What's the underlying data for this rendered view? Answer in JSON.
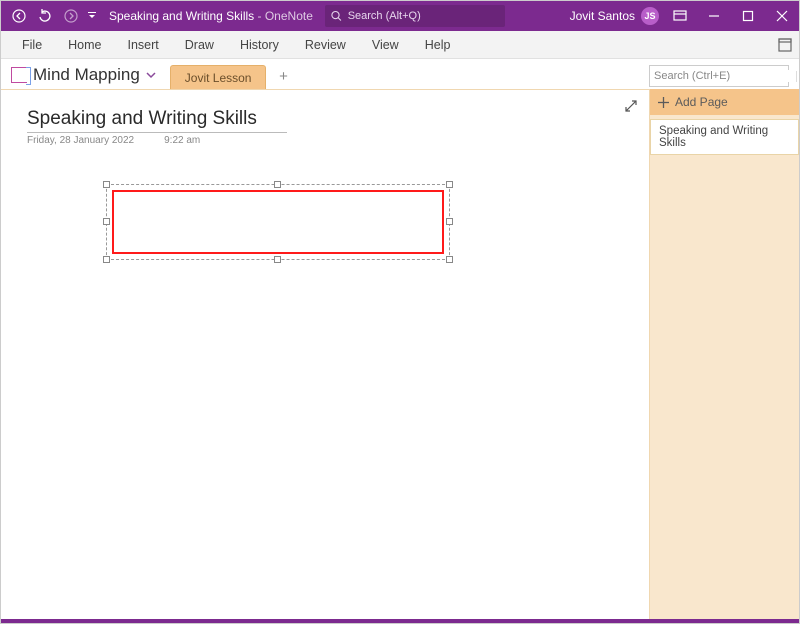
{
  "titlebar": {
    "doc_title": "Speaking and Writing Skills",
    "app_suffix": "  -  OneNote",
    "search_placeholder": "Search (Alt+Q)",
    "user_name": "Jovit Santos",
    "user_initials": "JS"
  },
  "ribbon": {
    "tabs": [
      "File",
      "Home",
      "Insert",
      "Draw",
      "History",
      "Review",
      "View",
      "Help"
    ]
  },
  "sectionbar": {
    "notebook_name": "Mind Mapping",
    "section_tab": "Jovit Lesson",
    "search_placeholder": "Search (Ctrl+E)"
  },
  "page": {
    "title": "Speaking and Writing Skills",
    "date": "Friday, 28 January 2022",
    "time": "9:22 am"
  },
  "pagepanel": {
    "add_label": "Add Page",
    "pages": [
      "Speaking and Writing Skills"
    ]
  }
}
